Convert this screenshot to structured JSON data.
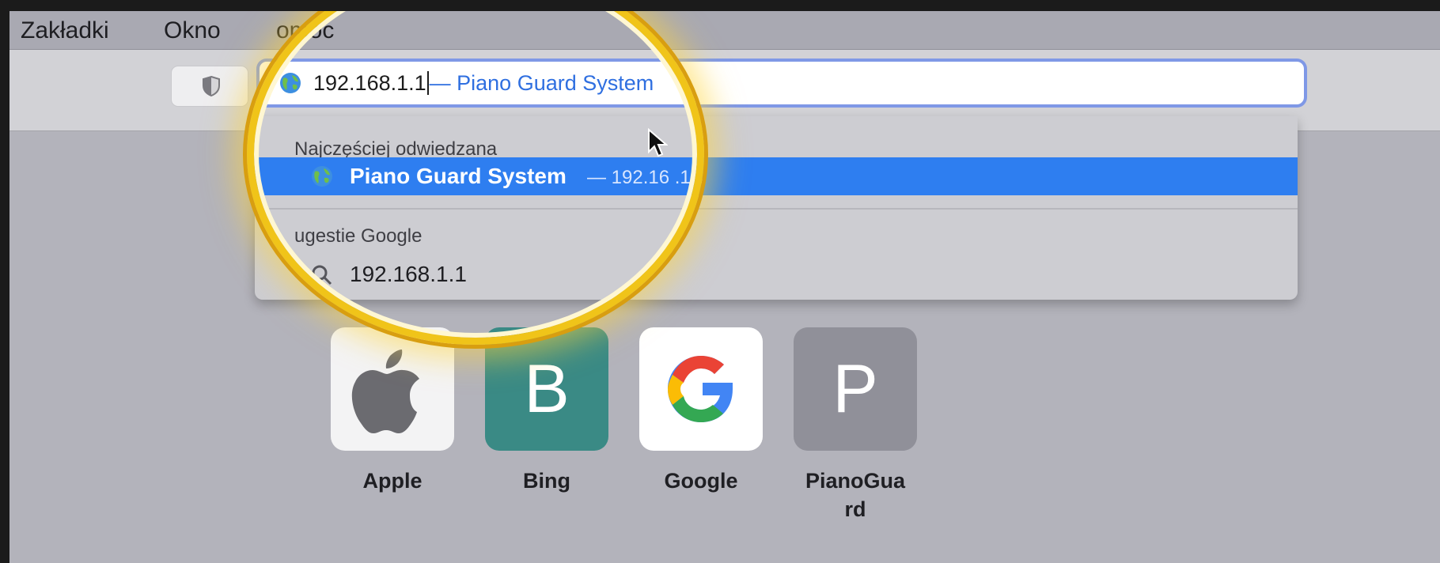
{
  "menubar": {
    "items": [
      "Zakładki",
      "Okno",
      "omoc"
    ]
  },
  "address_bar": {
    "typed_text": "192.168.1.1",
    "inline_suggestion": "— Piano Guard System"
  },
  "dropdown": {
    "most_visited_header": "Najczęściej odwiedzana",
    "selected_item_title": "Piano Guard System",
    "selected_item_url": "— 192.16  .1.1",
    "google_header": "ugestie Google",
    "google_item": "192.168.1.1"
  },
  "favorites": [
    {
      "label": "Apple",
      "letter": "",
      "bg": "#f3f3f4"
    },
    {
      "label": "Bing",
      "letter": "B",
      "bg": "#3a8a85"
    },
    {
      "label": "Google",
      "letter": "",
      "bg": "#ffffff"
    },
    {
      "label": "PianoGua\nrd",
      "letter": "P",
      "bg": "#909099"
    }
  ],
  "colors": {
    "highlight_ring": "#f0c419",
    "selection_blue": "#2e7ef0",
    "suggestion_blue": "#2f6fe0"
  }
}
